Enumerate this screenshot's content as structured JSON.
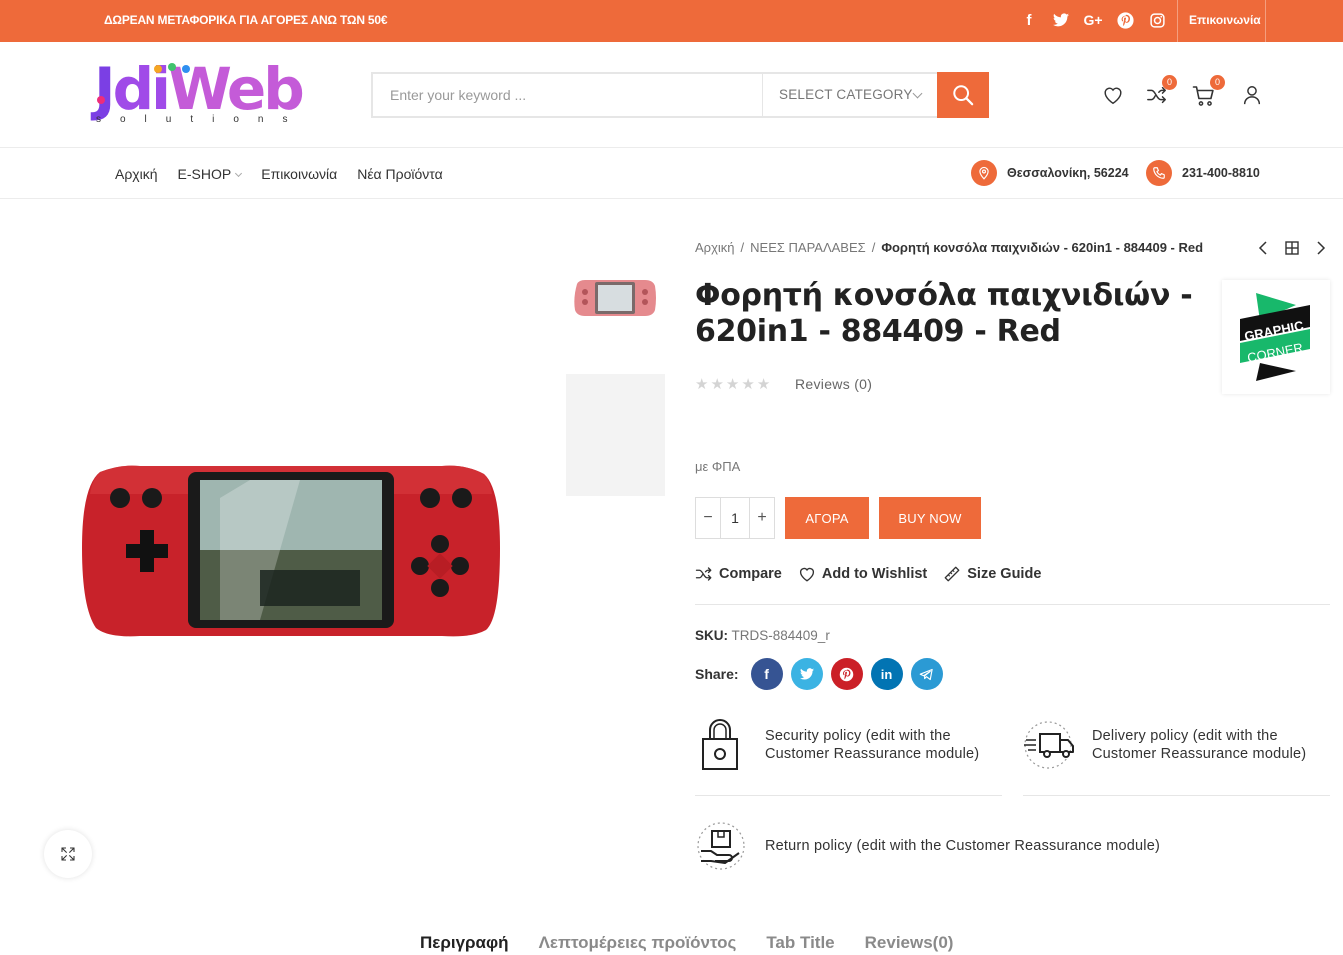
{
  "topbar": {
    "promo": "ΔΩΡΕΑΝ ΜΕΤΑΦΟΡΙΚΑ ΓΙΑ ΑΓΟΡΕΣ ΑΝΩ ΤΩΝ 50€",
    "socials": [
      "facebook-icon",
      "twitter-icon",
      "google-plus-icon",
      "pinterest-icon",
      "instagram-icon"
    ],
    "contact": "Επικοινωνία",
    "bg_color": "#ee6a3a"
  },
  "logo": {
    "text_a": "Jdi",
    "text_b": "Web",
    "tagline": "solutions"
  },
  "search": {
    "placeholder": "Enter your keyword ...",
    "category": "SELECT CATEGORY"
  },
  "header_icons": {
    "compare_count": "0",
    "cart_count": "0"
  },
  "nav": {
    "items": [
      "Αρχική",
      "E-SHOP",
      "Επικοινωνία",
      "Νέα Προϊόντα"
    ],
    "location": "Θεσσαλονίκη, 56224",
    "phone": "231-400-8810"
  },
  "breadcrumb": {
    "home": "Αρχική",
    "category": "ΝΕΕΣ ΠΑΡΑΛΑΒΕΣ",
    "current": "Φορητή κονσόλα παιχνιδιών - 620in1 - 884409 - Red"
  },
  "product": {
    "title": "Φορητή κονσόλα παιχνιδιών - 620in1 - 884409 - Red",
    "rating": 0,
    "reviews": "Reviews (0)",
    "vat_note": "με ΦΠΑ",
    "quantity": "1",
    "add_to_cart": "ΑΓΟΡΑ",
    "buy_now": "BUY NOW",
    "sku_label": "SKU:",
    "sku": "TRDS-884409_r",
    "brand": {
      "line1": "GRAPHIC",
      "line2": "CORNER"
    }
  },
  "actions": {
    "compare": "Compare",
    "wishlist": "Add to Wishlist",
    "size_guide": "Size Guide"
  },
  "share": {
    "label": "Share:",
    "networks": [
      "facebook-icon",
      "twitter-icon",
      "pinterest-icon",
      "linkedin-icon",
      "telegram-icon"
    ]
  },
  "policies": {
    "security": [
      "Security policy (edit with the",
      "Customer Reassurance module)"
    ],
    "delivery": [
      "Delivery policy (edit with the",
      "Customer Reassurance module)"
    ],
    "return": "Return policy (edit with the Customer Reassurance module)"
  },
  "tabs": [
    "Περιγραφή",
    "Λεπτομέρειες προϊόντος",
    "Tab Title",
    "Reviews(0)"
  ],
  "colors": {
    "accent": "#ee6a3a",
    "facebook": "#365493",
    "twitter": "#3bb3e3",
    "pinterest": "#cb2027",
    "linkedin": "#0274b3",
    "telegram": "#2b9ad4"
  }
}
